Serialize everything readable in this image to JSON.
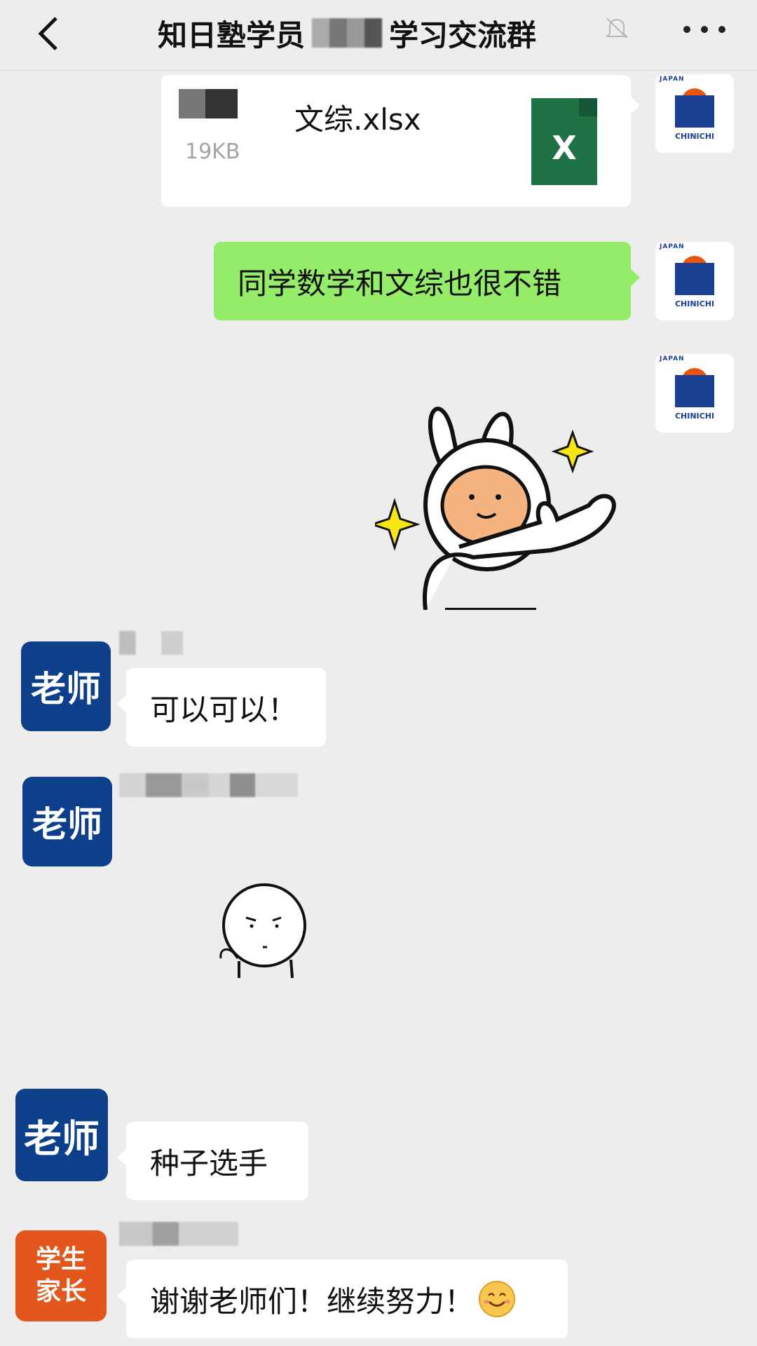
{
  "header": {
    "title_prefix": "知日塾学员",
    "title_suffix": "学习交流群"
  },
  "messages": {
    "file": {
      "name": "文综.xlsx",
      "size": "19KB",
      "icon_letter": "X"
    },
    "self_text": "同学数学和文综也很不错",
    "teacher1": {
      "avatar_label": "老师",
      "text": "可以可以！"
    },
    "teacher2": {
      "avatar_label": "老师"
    },
    "teacher3": {
      "avatar_label": "老师",
      "text": "种子选手"
    },
    "parent": {
      "avatar_line1": "学生",
      "avatar_line2": "家长",
      "text": "谢谢老师们！继续努力！"
    }
  },
  "avatar_brand": {
    "tag": "JAPAN",
    "caption": "CHINICHI"
  },
  "colors": {
    "background": "#ededed",
    "self_bubble": "#95ec69",
    "teacher": "#0d3f8b",
    "parent": "#e4571c",
    "excel": "#1f7244"
  }
}
